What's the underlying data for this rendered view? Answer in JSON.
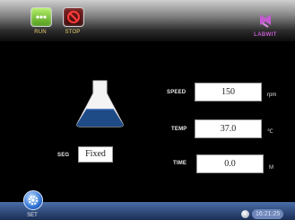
{
  "toolbar": {
    "run_label": "RUN",
    "stop_label": "STOP",
    "run_icon": "play-dots-icon",
    "stop_icon": "no-sign-icon"
  },
  "brand": {
    "text": "LABWIT",
    "logo_icon": "brand-logo-icon",
    "color": "#c35bd0"
  },
  "flask": {
    "icon": "flask-icon",
    "fill_color": "#1e4a86"
  },
  "fields": {
    "speed": {
      "label": "SPEED",
      "value": "150",
      "unit": "rpm"
    },
    "temp": {
      "label": "TEMP",
      "value": "37.0",
      "unit": "℃"
    },
    "time": {
      "label": "TIME",
      "value": "0.0",
      "unit": "M"
    }
  },
  "seg": {
    "label": "SEG",
    "value": "Fixed"
  },
  "bottom": {
    "set_label": "SET",
    "set_icon": "gear-icon",
    "clock": "16:21:25"
  },
  "colors": {
    "run_green": "#6fc12a",
    "stop_red": "#c12a2a",
    "bottom_bar": "#2a4a86",
    "background": "#000000"
  }
}
